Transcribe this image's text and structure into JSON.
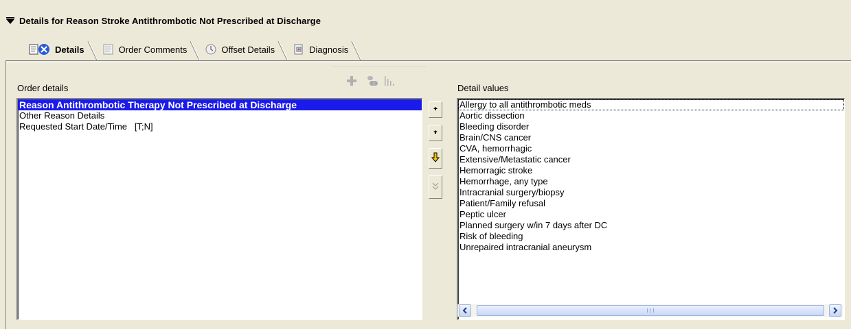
{
  "header": {
    "title": "Details for Reason Stroke Antithrombotic Not Prescribed at Discharge"
  },
  "tabs": [
    {
      "label": "Details",
      "icon": "details-icon",
      "active": true
    },
    {
      "label": "Order Comments",
      "icon": "comments-icon",
      "active": false
    },
    {
      "label": "Offset Details",
      "icon": "clock-icon",
      "active": false
    },
    {
      "label": "Diagnosis",
      "icon": "diagnosis-icon",
      "active": false
    }
  ],
  "toolbar": {
    "icons": [
      "add-icon",
      "pill-icon",
      "chart-icon"
    ]
  },
  "order_details": {
    "label": "Order details",
    "items": [
      "Reason Antithrombotic Therapy Not Prescribed at Discharge",
      "Other Reason Details",
      "Requested Start Date/Time   [T;N]"
    ],
    "selected_index": 0
  },
  "detail_values": {
    "label": "Detail values",
    "items": [
      "Allergy to all antithrombotic meds",
      "Aortic dissection",
      "Bleeding disorder",
      "Brain/CNS cancer",
      "CVA, hemorrhagic",
      "Extensive/Metastatic cancer",
      "Hemorragic stroke",
      "Hemorrhage, any type",
      "Intracranial surgery/biopsy",
      "Patient/Family refusal",
      "Peptic ulcer",
      "Planned surgery w/in 7 days after DC",
      "Risk of bleeding",
      "Unrepaired intracranial aneurysm"
    ],
    "focused_index": 0
  },
  "side_buttons": [
    "move-up-icon",
    "move-down-icon",
    "arrow-down-icon",
    "double-chevron-down-icon"
  ],
  "colors": {
    "background": "#ece9d8",
    "selection": "#1a1aea",
    "arrow_yellow": "#f5c400"
  }
}
